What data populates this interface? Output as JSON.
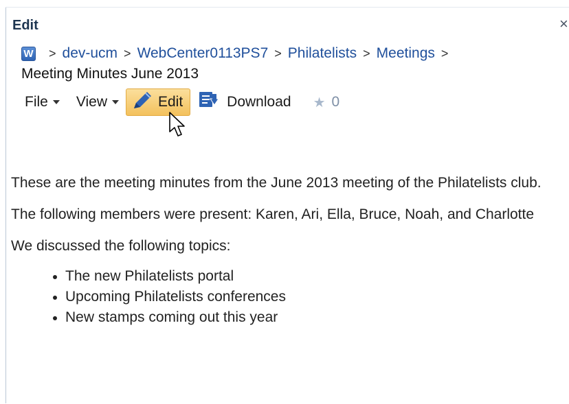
{
  "dialog": {
    "title": "Edit",
    "close_label": "×"
  },
  "breadcrumb": {
    "icon": "word-document-icon",
    "icon_letter": "W",
    "separator": ">",
    "items": [
      "dev-ucm",
      "WebCenter0113PS7",
      "Philatelists",
      "Meetings"
    ],
    "current": "Meeting Minutes June 2013"
  },
  "toolbar": {
    "file_label": "File",
    "view_label": "View",
    "edit_label": "Edit",
    "download_label": "Download",
    "rating_count": "0"
  },
  "document": {
    "paragraphs": [
      "These are the meeting minutes from the June 2013 meeting of the Philatelists club.",
      "The following members were present: Karen, Ari, Ella, Bruce, Noah, and Charlotte",
      "We discussed the following topics:"
    ],
    "topics": [
      "The new Philatelists portal",
      "Upcoming Philatelists conferences",
      "New stamps coming out this year"
    ]
  },
  "colors": {
    "title": "#1e3550",
    "link": "#1f4f9b",
    "edit_button_bg": "#f3c15d",
    "icon_blue": "#2e63b4"
  }
}
